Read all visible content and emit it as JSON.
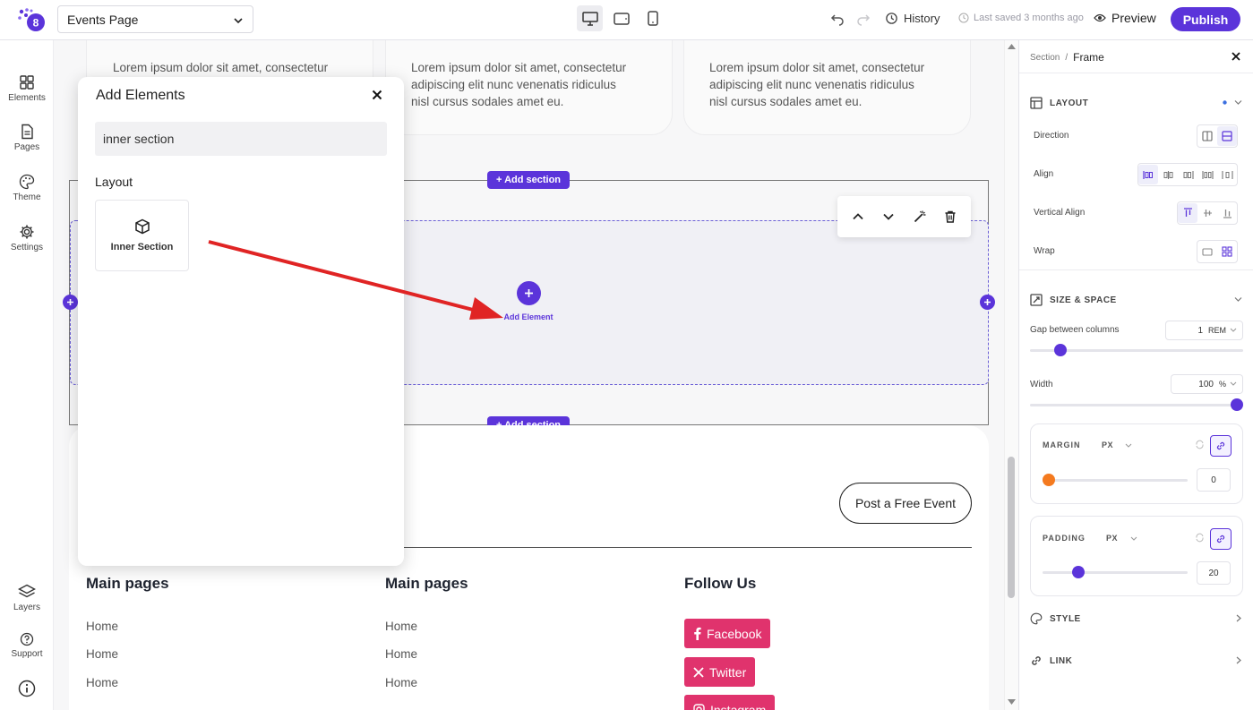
{
  "topbar": {
    "page_name": "Events Page",
    "history_label": "History",
    "last_saved": "Last saved 3 months ago",
    "preview_label": "Preview",
    "publish_label": "Publish"
  },
  "rail": {
    "elements": "Elements",
    "pages": "Pages",
    "theme": "Theme",
    "settings": "Settings",
    "layers": "Layers",
    "support": "Support"
  },
  "canvas": {
    "card_text": "Lorem ipsum dolor sit amet, consectetur adipiscing elit nunc venenatis ridiculus nisl cursus sodales amet eu.",
    "card1_line1": "Lorem ipsum dolor sit amet, consectetur",
    "card2_line1": "Lorem ipsum dolor sit amet, consectetur",
    "card2_line2": "adipiscing elit nunc venenatis ridiculus",
    "card2_line3": "nisl cursus sodales amet eu.",
    "card3_line1": "Lorem ipsum dolor sit amet, consectetur",
    "card3_line2": "adipiscing elit nunc venenatis ridiculus",
    "card3_line3": "nisl cursus sodales amet eu.",
    "add_section_label": "+ Add section",
    "add_element_label": "Add Element",
    "post_event_label": "Post a Free Event",
    "footer": {
      "col1_title": "Main pages",
      "col2_title": "Main pages",
      "col3_title": "Follow Us",
      "links": [
        "Home",
        "Home",
        "Home"
      ],
      "social": [
        "Facebook",
        "Twitter",
        "Instagram"
      ]
    }
  },
  "add_panel": {
    "title": "Add Elements",
    "search_value": "inner section",
    "section_label": "Layout",
    "tile_label": "Inner Section"
  },
  "right_panel": {
    "crumb_parent": "Section",
    "crumb_current": "Frame",
    "layout_title": "LAYOUT",
    "direction_label": "Direction",
    "align_label": "Align",
    "valign_label": "Vertical Align",
    "wrap_label": "Wrap",
    "size_title": "SIZE & SPACE",
    "gap_label": "Gap between columns",
    "gap_value": "1",
    "gap_unit": "REM",
    "width_label": "Width",
    "width_value": "100",
    "width_unit": "%",
    "margin_label": "MARGIN",
    "margin_unit": "PX",
    "margin_value": "0",
    "padding_label": "PADDING",
    "padding_unit": "PX",
    "padding_value": "20",
    "style_title": "STYLE",
    "link_title": "LINK",
    "gap_slider_fraction": 0.12,
    "width_slider_fraction": 1.0,
    "margin_slider_fraction": 0.0,
    "padding_slider_fraction": 0.22
  },
  "colors": {
    "accent": "#5b34da",
    "social": "#e0336d",
    "annotation_arrow": "#e02424"
  }
}
